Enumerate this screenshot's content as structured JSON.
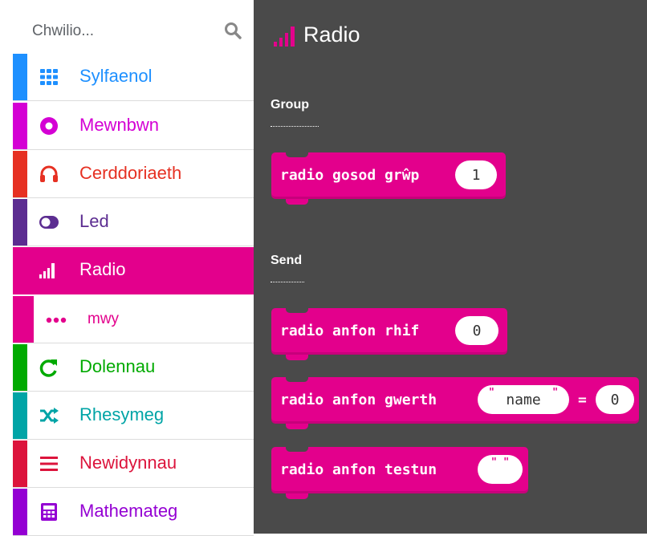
{
  "search": {
    "placeholder": "Chwilio..."
  },
  "categories": [
    {
      "label": "Sylfaenol",
      "color": "#1e90ff",
      "icon": "grid-icon"
    },
    {
      "label": "Mewnbwn",
      "color": "#d400d4",
      "icon": "circle-dot-icon"
    },
    {
      "label": "Cerddoriaeth",
      "color": "#e63022",
      "icon": "headphones-icon"
    },
    {
      "label": "Led",
      "color": "#5c2d91",
      "icon": "toggle-icon"
    },
    {
      "label": "Radio",
      "color": "#e3008c",
      "icon": "signal-bars-icon",
      "selected": true
    },
    {
      "label": "Dolennau",
      "color": "#00aa00",
      "icon": "loop-arrow-icon"
    },
    {
      "label": "Rhesymeg",
      "color": "#00a4a6",
      "icon": "shuffle-icon"
    },
    {
      "label": "Newidynnau",
      "color": "#dc143c",
      "icon": "list-lines-icon"
    },
    {
      "label": "Mathemateg",
      "color": "#9400d3",
      "icon": "calculator-icon"
    }
  ],
  "more": {
    "label": "mwy",
    "icon": "ellipsis-icon"
  },
  "flyout": {
    "title": "Radio",
    "groups": {
      "group": "Group",
      "send": "Send"
    },
    "blocks": {
      "set_group": {
        "text": "radio gosod grŵp",
        "value": "1"
      },
      "send_number": {
        "text": "radio anfon rhif",
        "value": "0"
      },
      "send_value": {
        "text": "radio anfon gwerth",
        "name": "name",
        "eq": "=",
        "value": "0"
      },
      "send_string": {
        "text": "radio anfon testun"
      }
    }
  }
}
